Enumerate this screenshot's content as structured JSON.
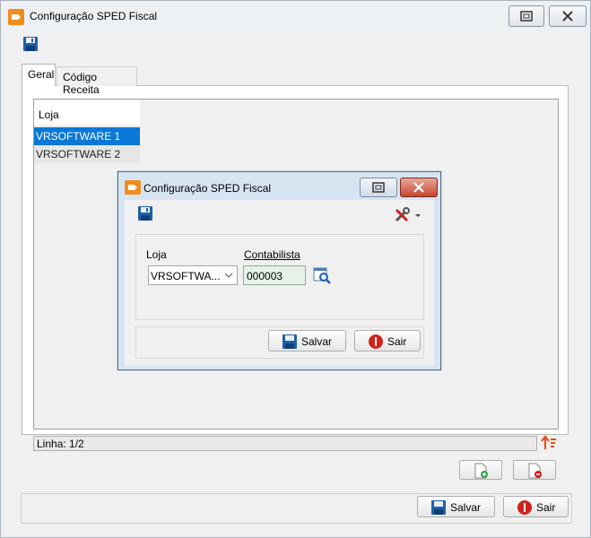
{
  "window": {
    "title": "Configuração SPED Fiscal"
  },
  "tabs": [
    {
      "label": "Geral"
    },
    {
      "label": "Código Receita"
    }
  ],
  "grid": {
    "header": "Loja",
    "rows": [
      "VRSOFTWARE 1",
      "VRSOFTWARE 2"
    ],
    "selected_row": 0
  },
  "status": {
    "text": "Linha: 1/2"
  },
  "footer": {
    "save_label": "Salvar",
    "exit_label": "Sair"
  },
  "dialog": {
    "title": "Configuração SPED Fiscal",
    "loja_label": "Loja",
    "loja_value": "VRSOFTWA...",
    "contabilista_label": "Contabilista",
    "contabilista_value": "000003",
    "save_label": "Salvar",
    "exit_label": "Sair"
  },
  "colors": {
    "accent_orange": "#f28c1d",
    "selection_blue": "#0a78d7",
    "exit_red": "#d0221c",
    "save_blue": "#1f5fa8"
  },
  "icons": [
    "app-icon",
    "maximize-icon",
    "close-icon",
    "save-icon",
    "tools-icon",
    "lookup-icon",
    "sort-icon",
    "add-document-icon",
    "remove-document-icon",
    "exit-icon"
  ]
}
